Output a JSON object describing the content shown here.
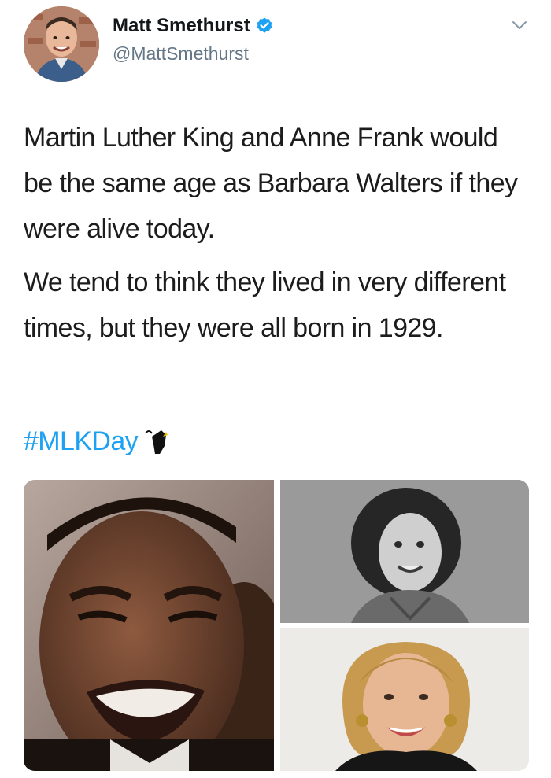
{
  "user": {
    "display_name": "Matt Smethurst",
    "handle": "@MattSmethurst",
    "verified": true
  },
  "tweet": {
    "paragraphs": [
      "Martin Luther King and Anne Frank would be the same age as Barbara Walters if they were alive today.",
      "We tend to think they lived in very different times, but they were all born in 1929."
    ],
    "hashtag": "#MLKDay",
    "hashtag_emoji": "raised-fist-hashflag-icon"
  },
  "media": {
    "count": 3,
    "images": [
      "photo-smiling-man",
      "photo-black-and-white-girl",
      "photo-blonde-woman"
    ]
  },
  "colors": {
    "link": "#1da1f2",
    "verified": "#1da1f2",
    "handle": "#657786",
    "text": "#1c1c1c"
  }
}
